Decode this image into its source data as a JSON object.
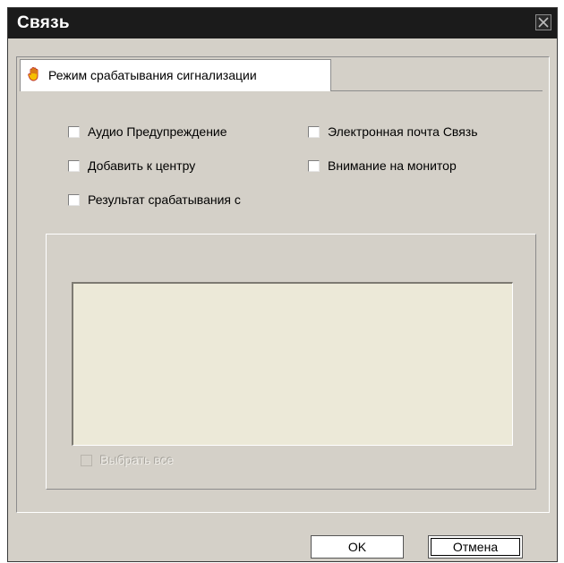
{
  "window": {
    "title": "Связь"
  },
  "tabs": [
    {
      "label": "Режим срабатывания сигнализации",
      "icon": "hand-icon"
    }
  ],
  "checkboxes": {
    "audio_warning": "Аудио Предупреждение",
    "email_link": "Электронная почта Связь",
    "add_to_center": "Добавить к центру",
    "monitor_attention": "Внимание на монитор",
    "trigger_result": "Результат срабатывания с"
  },
  "list": {
    "select_all": "Выбрать все"
  },
  "buttons": {
    "ok": "OK",
    "cancel": "Отмена"
  },
  "colors": {
    "titlebar": "#1b1b1b",
    "dialog_bg": "#d4d0c8",
    "listbox_bg": "#ece9d8"
  }
}
